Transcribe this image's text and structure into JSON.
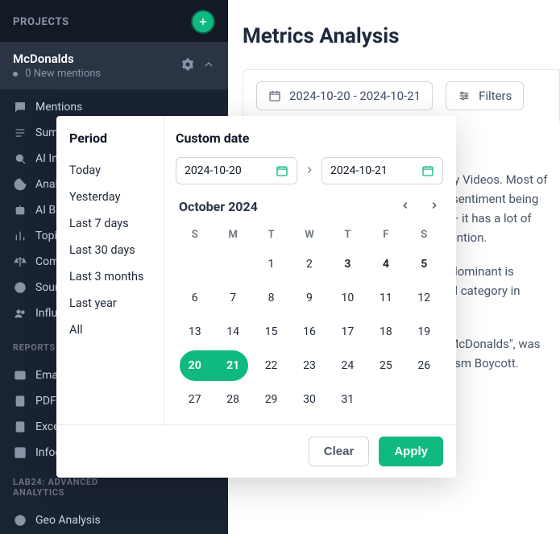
{
  "sidebar": {
    "section_title": "PROJECTS",
    "project": {
      "name": "McDonalds",
      "mentions_count": "0",
      "mentions_label": "New mentions"
    },
    "nav_items": [
      {
        "icon": "comment",
        "label": "Mentions"
      },
      {
        "icon": "list",
        "label": "Summary"
      },
      {
        "icon": "search",
        "label": "AI Insights"
      },
      {
        "icon": "pie",
        "label": "Analysis"
      },
      {
        "icon": "robot",
        "label": "AI Brand Assistant"
      },
      {
        "icon": "bars",
        "label": "Topic Analysis"
      },
      {
        "icon": "scale",
        "label": "Comparison"
      },
      {
        "icon": "globe",
        "label": "Sources"
      },
      {
        "icon": "users",
        "label": "Influencers"
      }
    ],
    "reports_label": "REPORTS",
    "report_items": [
      {
        "icon": "mail",
        "label": "Email Reports"
      },
      {
        "icon": "pdf",
        "label": "PDF Reports"
      },
      {
        "icon": "excel",
        "label": "Excel Reports"
      },
      {
        "icon": "chart",
        "label": "Infographics"
      }
    ],
    "lab_label_line1": "LAB24: ADVANCED",
    "lab_label_line2": "ANALYTICS",
    "lab_items": [
      {
        "icon": "globe",
        "label": "Geo Analysis"
      }
    ]
  },
  "main": {
    "heading": "Metrics Analysis",
    "date_range_label": "2024-10-20 - 2024-10-21",
    "filters_label": "Filters",
    "paragraphs": [
      "in your mcDonalds project are mainly Videos. Most of them originate from News, with the sentiment being negative. Take a look at X (Twitter) — it has a lot of admiration emotions worth your attention.",
      "neutral, but positive reach surprise, dominant is superior impact on results, impactful category in general.",
      "divided into several media: \"Trump McDonalds\", was about \"Happy Meal\", Palestine Activism Boycott."
    ]
  },
  "datepicker": {
    "period_heading": "Period",
    "periods": [
      "Today",
      "Yesterday",
      "Last 7 days",
      "Last 30 days",
      "Last 3 months",
      "Last year",
      "All"
    ],
    "custom_heading": "Custom date",
    "start": "2024-10-20",
    "end": "2024-10-21",
    "month_label": "October 2024",
    "dow": [
      "S",
      "M",
      "T",
      "W",
      "T",
      "F",
      "S"
    ],
    "offset": 2,
    "days_in_month": 31,
    "sel_start": 20,
    "sel_end": 21,
    "bold_days": [
      3,
      4,
      5
    ],
    "clear_label": "Clear",
    "apply_label": "Apply"
  }
}
